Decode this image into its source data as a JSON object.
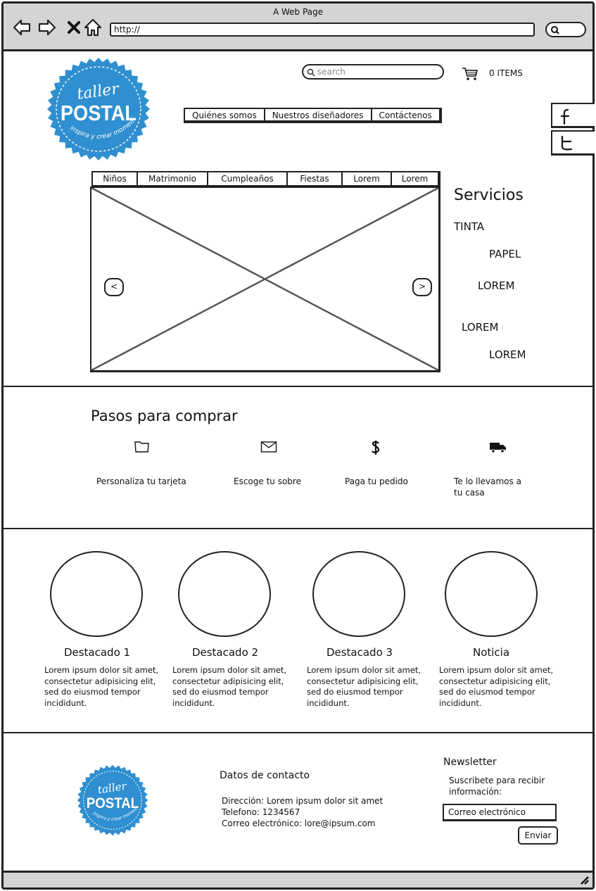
{
  "window": {
    "title": "A Web Page",
    "url": "http://"
  },
  "header": {
    "search_placeholder": "search",
    "cart_label": "0 ITEMS",
    "logo": {
      "word1": "taller",
      "word2": "POSTAL",
      "tagline": "inspira y crear momentos"
    },
    "nav": [
      "Quiénes somos",
      "Nuestros diseñadores",
      "Contáctenos"
    ]
  },
  "tabs": [
    "Niños",
    "Matrimonio",
    "Cumpleaños",
    "Fiestas",
    "Lorem",
    "Lorem"
  ],
  "carousel": {
    "prev": "<",
    "next": ">"
  },
  "servicios": {
    "title": "Servicios",
    "items": [
      "TINTA",
      "PAPEL",
      "LOREM",
      "LOREM",
      "LOREM"
    ]
  },
  "pasos": {
    "title": "Pasos para comprar",
    "steps": [
      {
        "icon": "folder-icon",
        "label": "Personaliza tu tarjeta"
      },
      {
        "icon": "envelope-icon",
        "label": "Escoge tu sobre"
      },
      {
        "icon": "dollar-icon",
        "label": "Paga tu pedido"
      },
      {
        "icon": "truck-icon",
        "label": "Te lo llevamos a tu casa"
      }
    ]
  },
  "featured": [
    {
      "title": "Destacado 1",
      "body": "Lorem ipsum dolor sit amet, consectetur adipisicing elit, sed do eiusmod tempor incididunt."
    },
    {
      "title": "Destacado 2",
      "body": "Lorem ipsum dolor sit amet, consectetur adipisicing elit, sed do eiusmod tempor incididunt."
    },
    {
      "title": "Destacado 3",
      "body": "Lorem ipsum dolor sit amet, consectetur adipisicing elit, sed do eiusmod tempor incididunt."
    },
    {
      "title": "Noticia",
      "body": "Lorem ipsum dolor sit amet, consectetur adipisicing elit, sed do eiusmod tempor incididunt."
    }
  ],
  "footer": {
    "contact_title": "Datos de contacto",
    "address": "Dirección: Lorem ipsum dolor sit amet",
    "phone": "Telefono: 1234567",
    "email": "Correo electrónico: lore@ipsum.com",
    "newsletter_title": "Newsletter",
    "newsletter_text": "Suscribete para recibir información:",
    "email_placeholder": "Correo electrónico",
    "send_label": "Enviar"
  },
  "colors": {
    "logo_blue": "#2f8fd0",
    "logo_blue_dark": "#1f6fae",
    "chrome_gray": "#d4d4d4",
    "ink": "#222222"
  }
}
